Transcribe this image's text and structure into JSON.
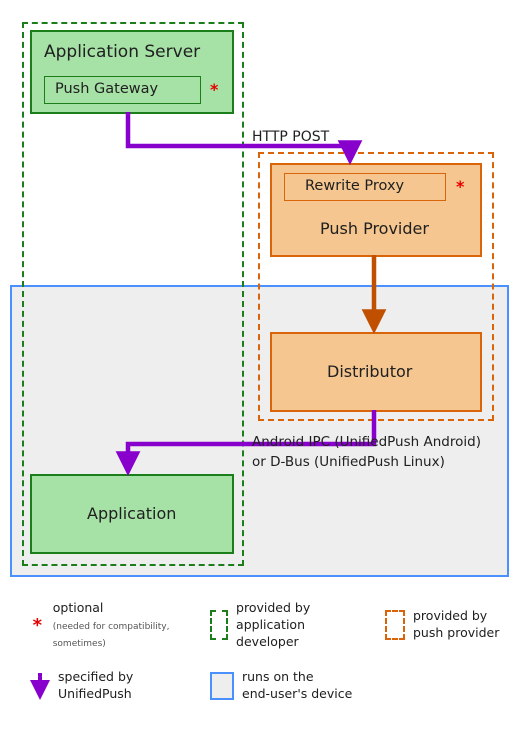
{
  "boxes": {
    "app_server": "Application Server",
    "push_gateway": "Push Gateway",
    "rewrite_proxy": "Rewrite Proxy",
    "push_provider": "Push Provider",
    "distributor": "Distributor",
    "application": "Application"
  },
  "labels": {
    "http_post": "HTTP POST",
    "ipc_line1": "Android IPC (UnifiedPush Android)",
    "ipc_line2": "or D-Bus (UnifiedPush Linux)"
  },
  "asterisk": "*",
  "legend": {
    "optional": "optional",
    "optional_sub": "(needed for compatibility, sometimes)",
    "provided_dev_l1": "provided by",
    "provided_dev_l2": "application developer",
    "provided_pp_l1": "provided by",
    "provided_pp_l2": "push provider",
    "specified_l1": "specified by",
    "specified_l2": "UnifiedPush",
    "runs_l1": "runs on the",
    "runs_l2": "end-user's device"
  },
  "colors": {
    "purple": "#8800cc",
    "orange_arrow": "#c05000",
    "green": "#1b7e1b",
    "orange": "#d9640a",
    "blue": "#4a90ff",
    "red": "#e60000"
  }
}
